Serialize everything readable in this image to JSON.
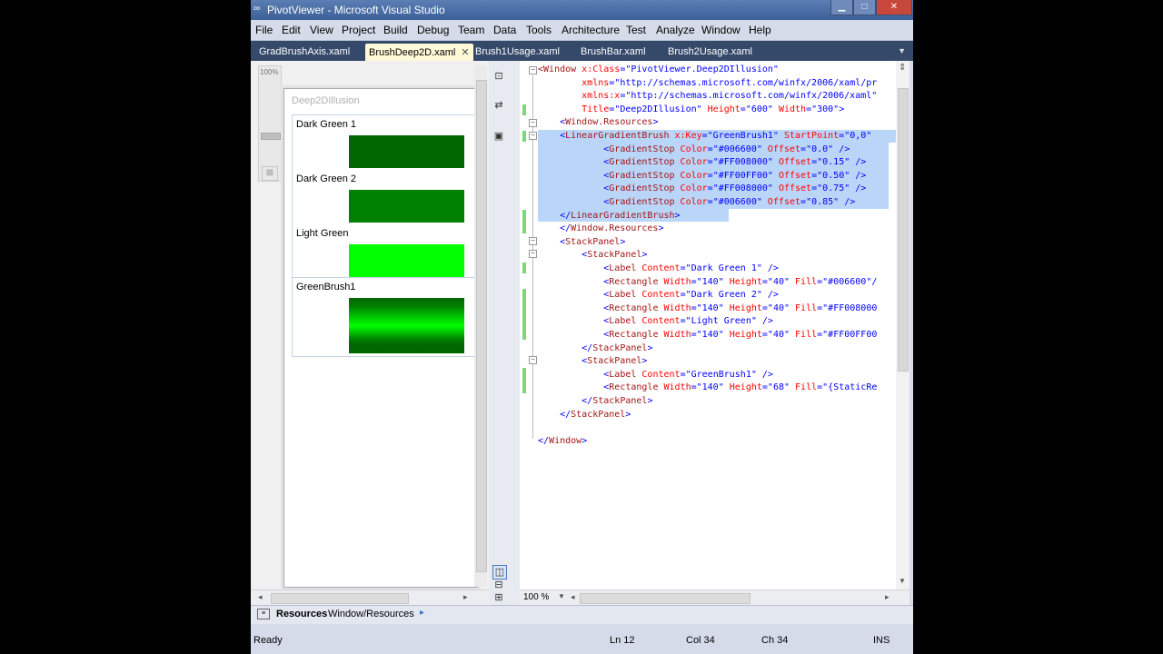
{
  "window": {
    "title": "PivotViewer - Microsoft Visual Studio",
    "minimize": "▁",
    "maximize": "□",
    "close": "✕"
  },
  "menu": [
    "File",
    "Edit",
    "View",
    "Project",
    "Build",
    "Debug",
    "Team",
    "Data",
    "Tools",
    "Architecture",
    "Test",
    "Analyze",
    "Window",
    "Help"
  ],
  "tabs": [
    {
      "label": "GradBrushAxis.xaml",
      "active": false
    },
    {
      "label": "BrushDeep2D.xaml",
      "active": true
    },
    {
      "label": "Brush1Usage.xaml",
      "active": false
    },
    {
      "label": "BrushBar.xaml",
      "active": false
    },
    {
      "label": "Brush2Usage.xaml",
      "active": false
    }
  ],
  "tab_close": "✕",
  "designer": {
    "zoom_label": "100%",
    "window_title": "Deep2DIllusion",
    "items": [
      {
        "label": "Dark Green 1",
        "color": "#006600"
      },
      {
        "label": "Dark Green 2",
        "color": "#008000"
      },
      {
        "label": "Light Green",
        "color": "#00FF00"
      }
    ],
    "brush_item": {
      "label": "GreenBrush1",
      "stops": [
        "#006600",
        "#008000",
        "#00FF00",
        "#008000",
        "#006600"
      ]
    }
  },
  "code": {
    "lines": [
      [
        {
          "t": "<",
          "c": "b"
        },
        {
          "t": "Window",
          "c": "b"
        },
        {
          "t": " x:Class",
          "c": "a"
        },
        {
          "t": "=",
          "c": "v"
        },
        {
          "t": "\"PivotViewer.Deep2DIllusion\"",
          "c": "v"
        }
      ],
      [
        {
          "t": "        xmlns",
          "c": "a"
        },
        {
          "t": "=",
          "c": "v"
        },
        {
          "t": "\"http://schemas.microsoft.com/winfx/2006/xaml/pr",
          "c": "v"
        }
      ],
      [
        {
          "t": "        xmlns:x",
          "c": "a"
        },
        {
          "t": "=",
          "c": "v"
        },
        {
          "t": "\"http://schemas.microsoft.com/winfx/2006/xaml\"",
          "c": "v"
        }
      ],
      [
        {
          "t": "        Title",
          "c": "a"
        },
        {
          "t": "=",
          "c": "v"
        },
        {
          "t": "\"Deep2DIllusion\"",
          "c": "v"
        },
        {
          "t": " Height",
          "c": "a"
        },
        {
          "t": "=",
          "c": "v"
        },
        {
          "t": "\"600\"",
          "c": "v"
        },
        {
          "t": " Width",
          "c": "a"
        },
        {
          "t": "=",
          "c": "v"
        },
        {
          "t": "\"300\"",
          "c": "v"
        },
        {
          "t": ">",
          "c": "v"
        }
      ],
      [
        {
          "t": "    <",
          "c": "v"
        },
        {
          "t": "Window.Resources",
          "c": "b"
        },
        {
          "t": ">",
          "c": "v"
        }
      ],
      [
        {
          "t": "    <",
          "c": "v"
        },
        {
          "t": "LinearGradientBrush",
          "c": "b"
        },
        {
          "t": " x:Key",
          "c": "a"
        },
        {
          "t": "=",
          "c": "v"
        },
        {
          "t": "\"GreenBrush1\"",
          "c": "v"
        },
        {
          "t": " StartPoint",
          "c": "a"
        },
        {
          "t": "=",
          "c": "v"
        },
        {
          "t": "\"0,0\"",
          "c": "v"
        }
      ],
      [
        {
          "t": "            <",
          "c": "v"
        },
        {
          "t": "GradientStop",
          "c": "b"
        },
        {
          "t": " Color",
          "c": "a"
        },
        {
          "t": "=",
          "c": "v"
        },
        {
          "t": "\"#006600\"",
          "c": "v"
        },
        {
          "t": " Offset",
          "c": "a"
        },
        {
          "t": "=",
          "c": "v"
        },
        {
          "t": "\"0.0\"",
          "c": "v"
        },
        {
          "t": " />",
          "c": "v"
        }
      ],
      [
        {
          "t": "            <",
          "c": "v"
        },
        {
          "t": "GradientStop",
          "c": "b"
        },
        {
          "t": " Color",
          "c": "a"
        },
        {
          "t": "=",
          "c": "v"
        },
        {
          "t": "\"#FF008000\"",
          "c": "v"
        },
        {
          "t": " Offset",
          "c": "a"
        },
        {
          "t": "=",
          "c": "v"
        },
        {
          "t": "\"0.15\"",
          "c": "v"
        },
        {
          "t": " />",
          "c": "v"
        }
      ],
      [
        {
          "t": "            <",
          "c": "v"
        },
        {
          "t": "GradientStop",
          "c": "b"
        },
        {
          "t": " Color",
          "c": "a"
        },
        {
          "t": "=",
          "c": "v"
        },
        {
          "t": "\"#FF00FF00\"",
          "c": "v"
        },
        {
          "t": " Offset",
          "c": "a"
        },
        {
          "t": "=",
          "c": "v"
        },
        {
          "t": "\"0.50\"",
          "c": "v"
        },
        {
          "t": " />",
          "c": "v"
        }
      ],
      [
        {
          "t": "            <",
          "c": "v"
        },
        {
          "t": "GradientStop",
          "c": "b"
        },
        {
          "t": " Color",
          "c": "a"
        },
        {
          "t": "=",
          "c": "v"
        },
        {
          "t": "\"#FF008000\"",
          "c": "v"
        },
        {
          "t": " Offset",
          "c": "a"
        },
        {
          "t": "=",
          "c": "v"
        },
        {
          "t": "\"0.75\"",
          "c": "v"
        },
        {
          "t": " />",
          "c": "v"
        }
      ],
      [
        {
          "t": "            <",
          "c": "v"
        },
        {
          "t": "GradientStop",
          "c": "b"
        },
        {
          "t": " Color",
          "c": "a"
        },
        {
          "t": "=",
          "c": "v"
        },
        {
          "t": "\"#006600\"",
          "c": "v"
        },
        {
          "t": " Offset",
          "c": "a"
        },
        {
          "t": "=",
          "c": "v"
        },
        {
          "t": "\"0.85\"",
          "c": "v"
        },
        {
          "t": " />",
          "c": "v"
        }
      ],
      [
        {
          "t": "    </",
          "c": "v"
        },
        {
          "t": "LinearGradientBrush",
          "c": "b"
        },
        {
          "t": ">",
          "c": "v"
        }
      ],
      [
        {
          "t": "    </",
          "c": "v"
        },
        {
          "t": "Window.Resources",
          "c": "b"
        },
        {
          "t": ">",
          "c": "v"
        }
      ],
      [
        {
          "t": "    <",
          "c": "v"
        },
        {
          "t": "StackPanel",
          "c": "b"
        },
        {
          "t": ">",
          "c": "v"
        }
      ],
      [
        {
          "t": "        <",
          "c": "v"
        },
        {
          "t": "StackPanel",
          "c": "b"
        },
        {
          "t": ">",
          "c": "v"
        }
      ],
      [
        {
          "t": "            <",
          "c": "v"
        },
        {
          "t": "Label",
          "c": "b"
        },
        {
          "t": " Content",
          "c": "a"
        },
        {
          "t": "=",
          "c": "v"
        },
        {
          "t": "\"Dark Green 1\"",
          "c": "v"
        },
        {
          "t": " />",
          "c": "v"
        }
      ],
      [
        {
          "t": "            <",
          "c": "v"
        },
        {
          "t": "Rectangle",
          "c": "b"
        },
        {
          "t": " Width",
          "c": "a"
        },
        {
          "t": "=",
          "c": "v"
        },
        {
          "t": "\"140\"",
          "c": "v"
        },
        {
          "t": " Height",
          "c": "a"
        },
        {
          "t": "=",
          "c": "v"
        },
        {
          "t": "\"40\"",
          "c": "v"
        },
        {
          "t": " Fill",
          "c": "a"
        },
        {
          "t": "=",
          "c": "v"
        },
        {
          "t": "\"#006600\"/",
          "c": "v"
        }
      ],
      [
        {
          "t": "            <",
          "c": "v"
        },
        {
          "t": "Label",
          "c": "b"
        },
        {
          "t": " Content",
          "c": "a"
        },
        {
          "t": "=",
          "c": "v"
        },
        {
          "t": "\"Dark Green 2\"",
          "c": "v"
        },
        {
          "t": " />",
          "c": "v"
        }
      ],
      [
        {
          "t": "            <",
          "c": "v"
        },
        {
          "t": "Rectangle",
          "c": "b"
        },
        {
          "t": " Width",
          "c": "a"
        },
        {
          "t": "=",
          "c": "v"
        },
        {
          "t": "\"140\"",
          "c": "v"
        },
        {
          "t": " Height",
          "c": "a"
        },
        {
          "t": "=",
          "c": "v"
        },
        {
          "t": "\"40\"",
          "c": "v"
        },
        {
          "t": " Fill",
          "c": "a"
        },
        {
          "t": "=",
          "c": "v"
        },
        {
          "t": "\"#FF008000",
          "c": "v"
        }
      ],
      [
        {
          "t": "            <",
          "c": "v"
        },
        {
          "t": "Label",
          "c": "b"
        },
        {
          "t": " Content",
          "c": "a"
        },
        {
          "t": "=",
          "c": "v"
        },
        {
          "t": "\"Light Green\"",
          "c": "v"
        },
        {
          "t": " />",
          "c": "v"
        }
      ],
      [
        {
          "t": "            <",
          "c": "v"
        },
        {
          "t": "Rectangle",
          "c": "b"
        },
        {
          "t": " Width",
          "c": "a"
        },
        {
          "t": "=",
          "c": "v"
        },
        {
          "t": "\"140\"",
          "c": "v"
        },
        {
          "t": " Height",
          "c": "a"
        },
        {
          "t": "=",
          "c": "v"
        },
        {
          "t": "\"40\"",
          "c": "v"
        },
        {
          "t": " Fill",
          "c": "a"
        },
        {
          "t": "=",
          "c": "v"
        },
        {
          "t": "\"#FF00FF00",
          "c": "v"
        }
      ],
      [
        {
          "t": "        </",
          "c": "v"
        },
        {
          "t": "StackPanel",
          "c": "b"
        },
        {
          "t": ">",
          "c": "v"
        }
      ],
      [
        {
          "t": "        <",
          "c": "v"
        },
        {
          "t": "StackPanel",
          "c": "b"
        },
        {
          "t": ">",
          "c": "v"
        }
      ],
      [
        {
          "t": "            <",
          "c": "v"
        },
        {
          "t": "Label",
          "c": "b"
        },
        {
          "t": " Content",
          "c": "a"
        },
        {
          "t": "=",
          "c": "v"
        },
        {
          "t": "\"GreenBrush1\"",
          "c": "v"
        },
        {
          "t": " />",
          "c": "v"
        }
      ],
      [
        {
          "t": "            <",
          "c": "v"
        },
        {
          "t": "Rectangle",
          "c": "b"
        },
        {
          "t": " Width",
          "c": "a"
        },
        {
          "t": "=",
          "c": "v"
        },
        {
          "t": "\"140\"",
          "c": "v"
        },
        {
          "t": " Height",
          "c": "a"
        },
        {
          "t": "=",
          "c": "v"
        },
        {
          "t": "\"68\"",
          "c": "v"
        },
        {
          "t": " Fill",
          "c": "a"
        },
        {
          "t": "=",
          "c": "v"
        },
        {
          "t": "\"{StaticRe",
          "c": "v"
        }
      ],
      [
        {
          "t": "        </",
          "c": "v"
        },
        {
          "t": "StackPanel",
          "c": "b"
        },
        {
          "t": ">",
          "c": "v"
        }
      ],
      [
        {
          "t": "    </",
          "c": "v"
        },
        {
          "t": "StackPanel",
          "c": "b"
        },
        {
          "t": ">",
          "c": "v"
        }
      ],
      [],
      [
        {
          "t": "</",
          "c": "v"
        },
        {
          "t": "Window",
          "c": "b"
        },
        {
          "t": ">",
          "c": "v"
        }
      ]
    ]
  },
  "code_zoom": "100 %",
  "breadcrumb": {
    "label": "Resources",
    "path": "Window/Resources"
  },
  "status": {
    "ready": "Ready",
    "ln": "Ln 12",
    "col": "Col 34",
    "ch": "Ch 34",
    "ins": "INS"
  }
}
